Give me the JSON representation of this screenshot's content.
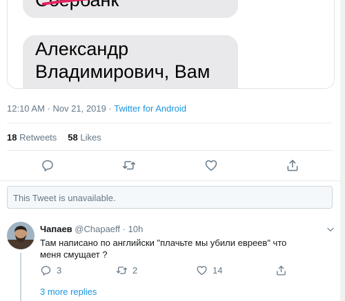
{
  "embed": {
    "bubble_top": "Сбербанк",
    "bubble_main_line1": "Александр",
    "bubble_main_line2": "Владимирович, Вам"
  },
  "meta": {
    "time": "12:10 AM",
    "dot": "·",
    "date": "Nov 21, 2019",
    "source": "Twitter for Android"
  },
  "stats": {
    "retweets_count": "18",
    "retweets_label": "Retweets",
    "likes_count": "58",
    "likes_label": "Likes"
  },
  "actions": {
    "icons": [
      "reply-icon",
      "retweet-icon",
      "like-icon",
      "share-icon"
    ]
  },
  "unavailable": {
    "text": "This Tweet is unavailable."
  },
  "reply": {
    "name": "Чапаев",
    "handle": "@Chapaeff",
    "dot": "·",
    "time": "10h",
    "text": "Там написано по английски \"плачьте мы убили евреев\" что меня смущает ?",
    "reply_count": "3",
    "retweet_count": "2",
    "like_count": "14"
  },
  "more_replies": "3 more replies",
  "colors": {
    "link": "#1b95e0",
    "muted": "#657786",
    "border": "#e6ecf0",
    "bubble": "#e9e9eb",
    "scribble": "#e0245e"
  }
}
